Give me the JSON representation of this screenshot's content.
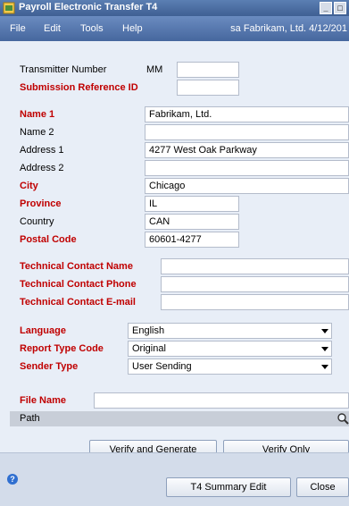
{
  "window": {
    "title": "Payroll Electronic Transfer T4",
    "minimize_glyph": "_",
    "maximize_glyph": "□"
  },
  "menu": {
    "items": [
      "File",
      "Edit",
      "Tools",
      "Help"
    ],
    "user_info": "sa  Fabrikam, Ltd.  4/12/201"
  },
  "transmitter": {
    "number_label": "Transmitter Number",
    "number_prefix": "MM",
    "number_value": "",
    "submission_label": "Submission Reference ID",
    "submission_value": ""
  },
  "address": {
    "name1_label": "Name 1",
    "name1_value": "Fabrikam, Ltd.",
    "name2_label": "Name 2",
    "name2_value": "",
    "address1_label": "Address 1",
    "address1_value": "4277 West Oak Parkway",
    "address2_label": "Address 2",
    "address2_value": "",
    "city_label": "City",
    "city_value": "Chicago",
    "province_label": "Province",
    "province_value": "IL",
    "country_label": "Country",
    "country_value": "CAN",
    "postal_label": "Postal Code",
    "postal_value": "60601-4277"
  },
  "contact": {
    "name_label": "Technical Contact Name",
    "name_value": "",
    "phone_label": "Technical Contact Phone",
    "phone_value": "",
    "email_label": "Technical Contact E-mail",
    "email_value": ""
  },
  "options": {
    "language_label": "Language",
    "language_value": "English",
    "report_label": "Report Type Code",
    "report_value": "Original",
    "sender_label": "Sender Type",
    "sender_value": "User Sending"
  },
  "file": {
    "name_label": "File Name",
    "name_value": "",
    "path_label": "Path"
  },
  "buttons": {
    "verify_generate": "Verify and Generate",
    "verify_only": "Verify Only",
    "t4_summary": "T4 Summary Edit",
    "close": "Close"
  },
  "icons": [
    "app-icon",
    "minimize-icon",
    "maximize-icon",
    "lookup-icon",
    "help-icon"
  ],
  "colors": {
    "required_label": "#c00000",
    "titlebar": "#3f5f93",
    "background": "#e8eef7"
  }
}
